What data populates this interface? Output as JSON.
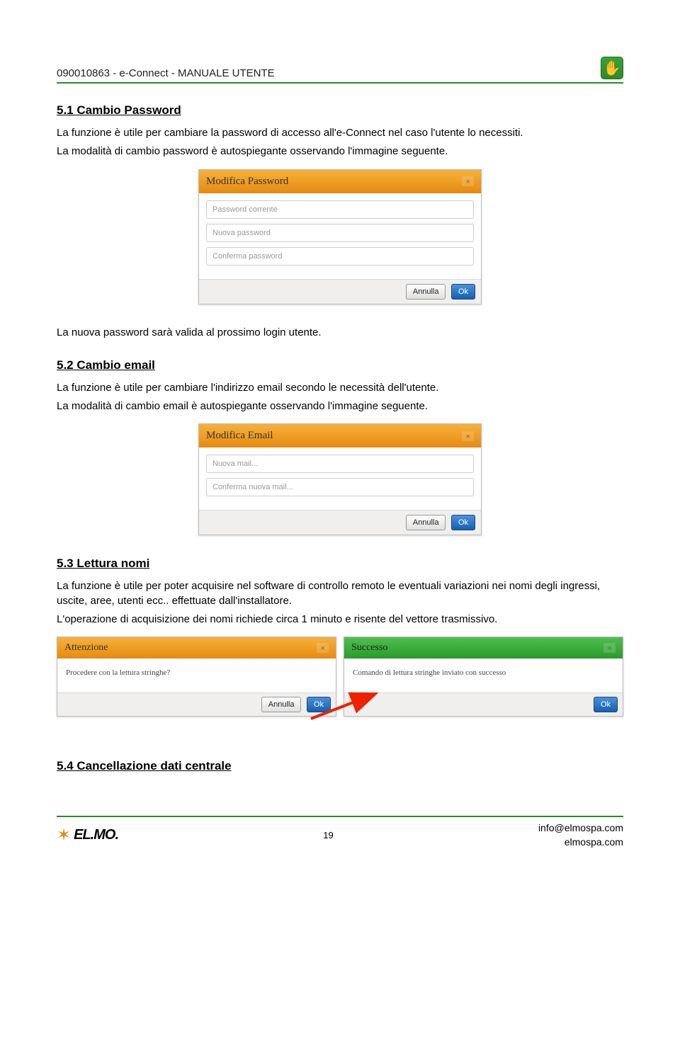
{
  "header": {
    "doc_id": "090010863  -  e-Connect -   MANUALE UTENTE"
  },
  "section51": {
    "heading": "5.1 Cambio Password",
    "p1": "La funzione è utile per cambiare la password di accesso all'e-Connect nel caso l'utente lo necessiti.",
    "p2": "La modalità di cambio password è autospiegante osservando l'immagine seguente.",
    "after": "La nuova password sarà valida al prossimo login utente."
  },
  "dlg_pwd": {
    "title": "Modifica Password",
    "ph_current": "Password corrente",
    "ph_new": "Nuova password",
    "ph_confirm": "Conferma password",
    "btn_cancel": "Annulla",
    "btn_ok": "Ok"
  },
  "section52": {
    "heading": "5.2 Cambio email",
    "p1": "La funzione è utile per cambiare l'indirizzo email secondo le necessità dell'utente.",
    "p2": "La modalità di cambio email è autospiegante osservando l'immagine seguente."
  },
  "dlg_email": {
    "title": "Modifica Email",
    "ph_new": "Nuova mail...",
    "ph_confirm": "Conferma nuova mail...",
    "btn_cancel": "Annulla",
    "btn_ok": "Ok"
  },
  "section53": {
    "heading": "5.3 Lettura nomi",
    "p1": "La funzione è utile per poter acquisire nel software di controllo remoto le eventuali variazioni nei nomi degli ingressi, uscite, aree, utenti ecc.. effettuate dall'installatore.",
    "p2": "L'operazione di acquisizione dei nomi richiede circa 1 minuto e risente del vettore trasmissivo."
  },
  "dlg_attn": {
    "title": "Attenzione",
    "msg": "Procedere con la lettura stringhe?",
    "btn_cancel": "Annulla",
    "btn_ok": "Ok"
  },
  "dlg_succ": {
    "title": "Successo",
    "msg": "Comando di lettura stringhe inviato con successo",
    "btn_ok": "Ok"
  },
  "section54": {
    "heading": "5.4 Cancellazione dati centrale"
  },
  "footer": {
    "logo_text": "EL.MO.",
    "page_num": "19",
    "email": "info@elmospa.com",
    "site": "elmospa.com"
  }
}
